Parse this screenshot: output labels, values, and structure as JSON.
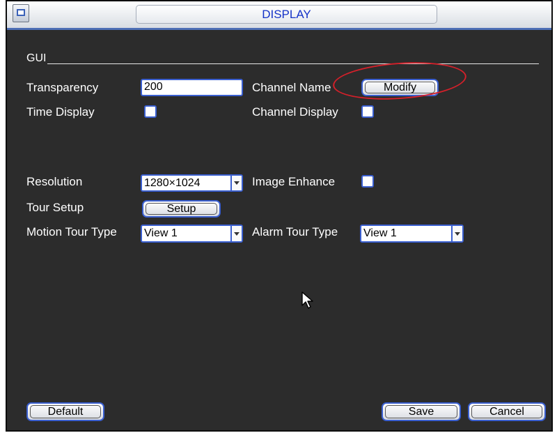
{
  "window": {
    "title": "DISPLAY",
    "icons": {
      "logo": "monitor-icon",
      "cursor": "arrow-cursor-icon"
    }
  },
  "gui": {
    "section_label": "GUI",
    "transparency": {
      "label": "Transparency",
      "value": "200"
    },
    "channel_name": {
      "label": "Channel Name",
      "button": "Modify"
    },
    "time_display": {
      "label": "Time Display",
      "checked": false
    },
    "channel_display": {
      "label": "Channel Display",
      "checked": false
    },
    "resolution": {
      "label": "Resolution",
      "value": "1280×1024"
    },
    "image_enhance": {
      "label": "Image Enhance",
      "checked": false
    },
    "tour_setup": {
      "label": "Tour Setup",
      "button": "Setup"
    },
    "motion_tour_type": {
      "label": "Motion Tour Type",
      "value": "View 1"
    },
    "alarm_tour_type": {
      "label": "Alarm Tour Type",
      "value": "View 1"
    }
  },
  "footer": {
    "default": "Default",
    "save": "Save",
    "cancel": "Cancel"
  },
  "colors": {
    "panel_background": "#2c2c2c",
    "title_text": "#1432c7",
    "control_border": "#3a5fd0",
    "annotation": "#d4202a"
  }
}
